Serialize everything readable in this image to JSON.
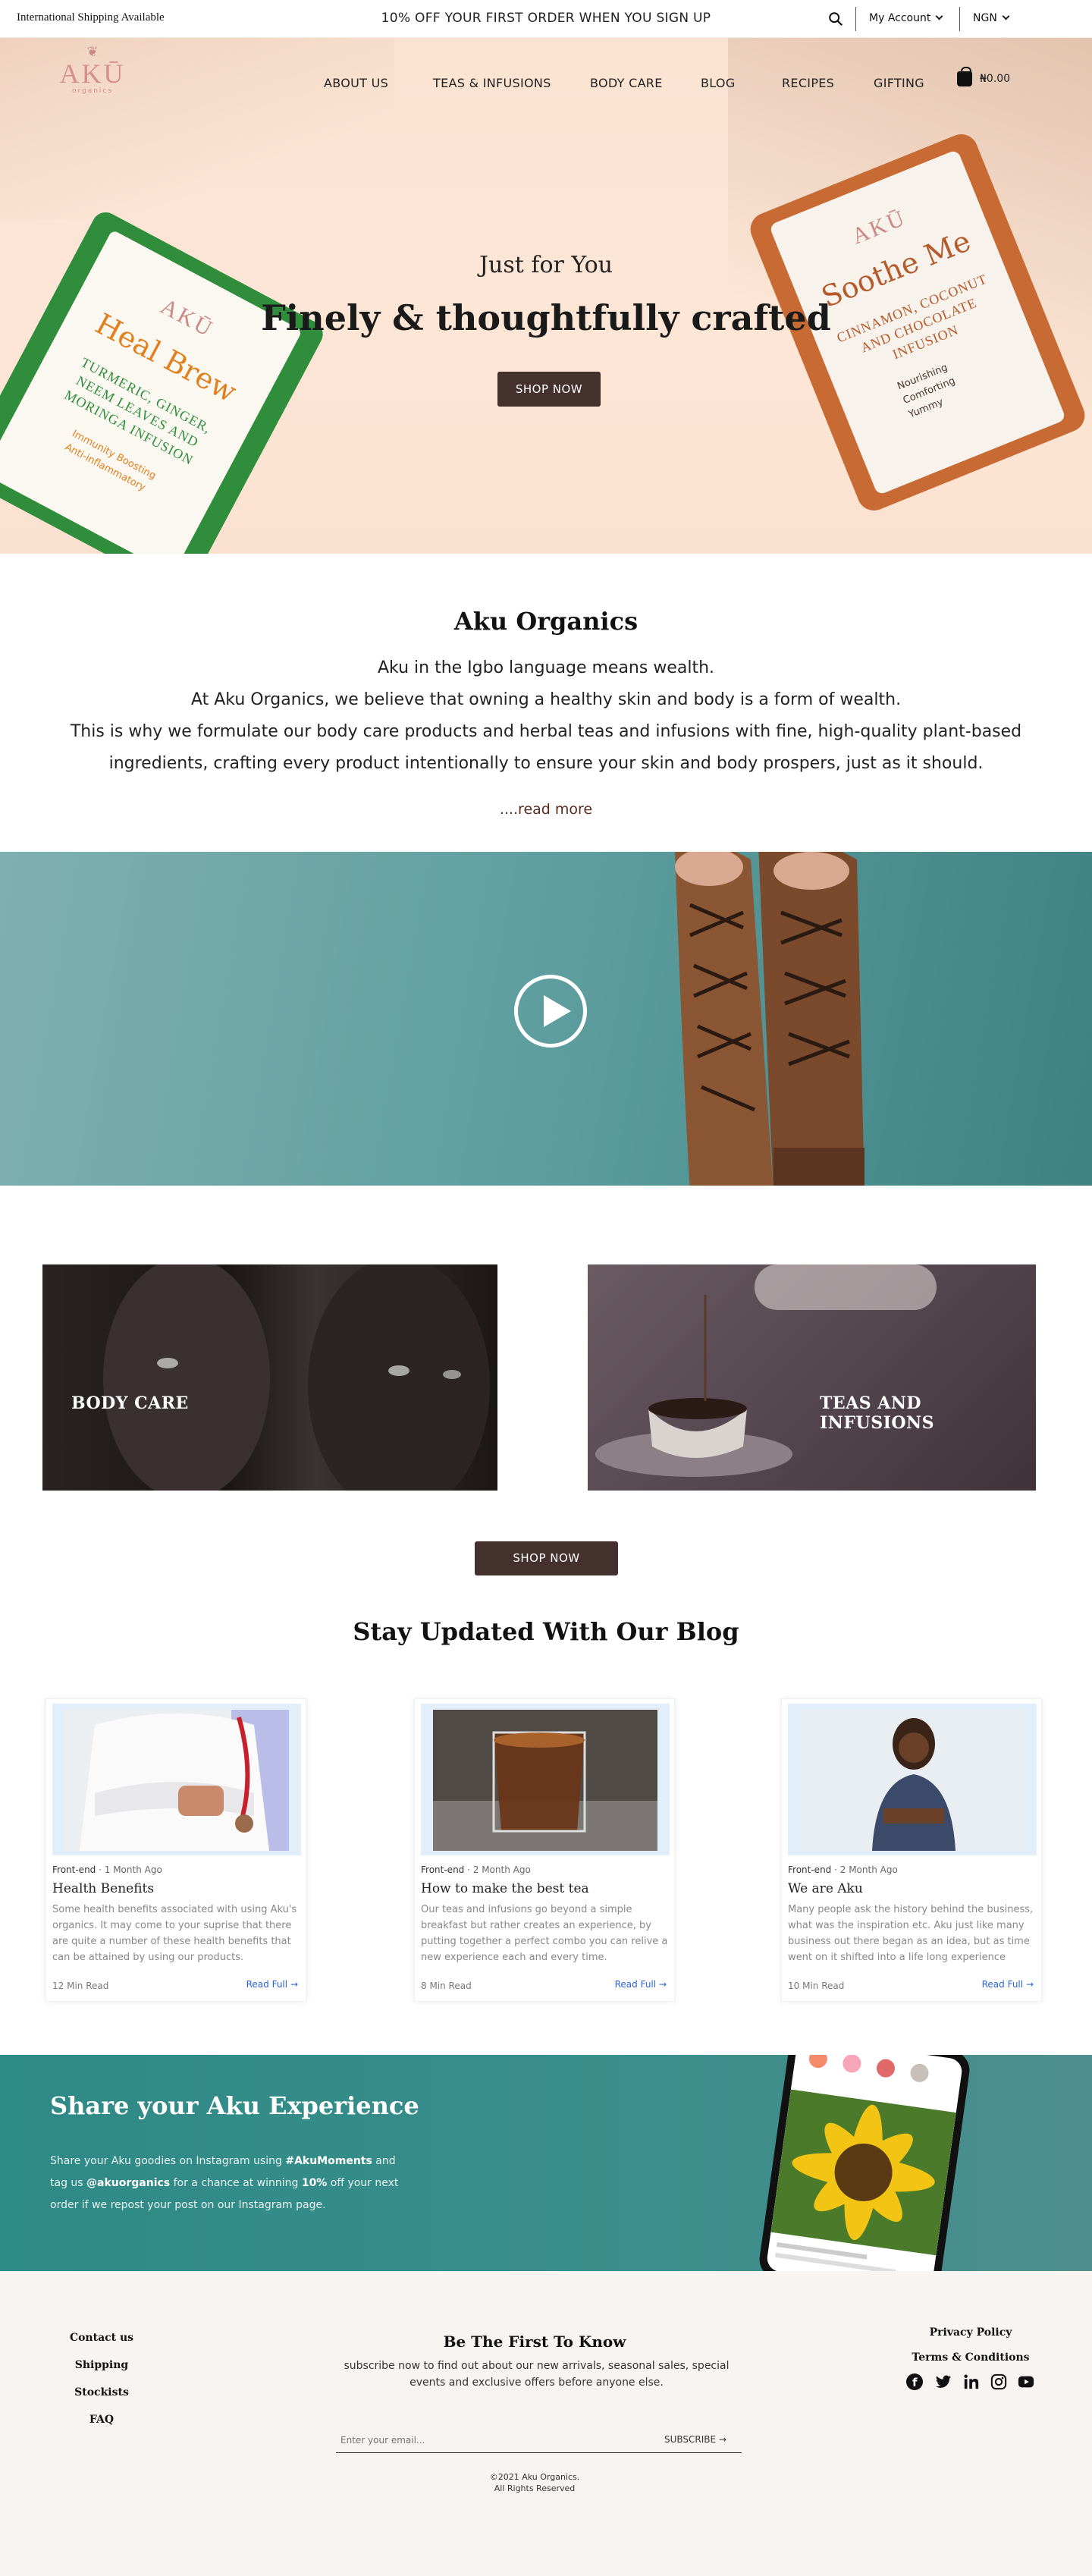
{
  "topbar": {
    "shipping": "International Shipping Available",
    "promo": "10% OFF YOUR FIRST ORDER WHEN YOU SIGN UP",
    "account": "My Account",
    "currency": "NGN"
  },
  "header": {
    "logo": "AKŪ",
    "logo_sub": "organics",
    "nav": [
      "ABOUT US",
      "TEAS & INFUSIONS",
      "BODY CARE",
      "BLOG",
      "RECIPES",
      "GIFTING"
    ],
    "cart_total": "₦0.00"
  },
  "hero": {
    "subtitle": "Just for You",
    "title": "Finely & thoughtfully crafted",
    "button": "SHOP NOW",
    "pack_left": {
      "brand": "AKŪ",
      "name": "Heal Brew",
      "desc": "TURMERIC, GINGER, NEEM LEAVES AND MORINGA INFUSION",
      "list": [
        "Immunity Boosting",
        "Anti-inflammatory"
      ]
    },
    "pack_right": {
      "brand": "AKŪ",
      "name": "Soothe Me",
      "desc": "CINNAMON, COCONUT AND CHOCOLATE INFUSION",
      "list": [
        "Nourishing",
        "Comforting",
        "Yummy"
      ]
    }
  },
  "about": {
    "title": "Aku Organics",
    "lines": [
      "Aku in the Igbo language means wealth.",
      "At Aku Organics, we believe that owning a healthy skin and body is a form of wealth.",
      "This is why we formulate our body care products and herbal teas and infusions with fine, high-quality plant-based",
      "ingredients, crafting every product intentionally to ensure your skin and body prospers, just as it should."
    ],
    "read_more": "....read more"
  },
  "categories": {
    "body_care": "BODY CARE",
    "teas": "TEAS AND INFUSIONS",
    "button": "SHOP NOW"
  },
  "blog": {
    "title": "Stay Updated With Our Blog",
    "posts": [
      {
        "category": "Front-end",
        "date": "1 Month Ago",
        "title": "Health Benefits",
        "excerpt": "Some health benefits associated with using Aku's organics. It may come to your suprise that there are quite a number of these health benefits that can be attained by using our products.",
        "read_time": "12 Min Read",
        "link": "Read Full"
      },
      {
        "category": "Front-end",
        "date": "2 Month Ago",
        "title": "How to make the best tea",
        "excerpt": "Our teas and infusions go beyond a simple breakfast but rather creates an experience, by putting together a perfect combo you can relive a new experience each and every time.",
        "read_time": "8 Min Read",
        "link": "Read Full"
      },
      {
        "category": "Front-end",
        "date": "2 Month Ago",
        "title": "We are Aku",
        "excerpt": "Many people ask the history behind the business, what was the inspiration etc. Aku just like many business out there began as an idea, but as time went on it shifted into a life long experience",
        "read_time": "10 Min Read",
        "link": "Read Full"
      }
    ]
  },
  "share": {
    "title": "Share your Aku Experience",
    "text_1": "Share your Aku goodies on Instagram using ",
    "hashtag": "#AkuMoments",
    "text_2": " and tag us ",
    "handle": "@akuorganics",
    "text_3": " for a chance at winning ",
    "percent": "10%",
    "text_4": " off your next order if we repost your post on our Instagram page."
  },
  "footer": {
    "left_links": [
      "Contact us",
      "Shipping",
      "Stockists",
      "FAQ"
    ],
    "right_links": [
      "Privacy Policy",
      "Terms & Conditions"
    ],
    "newsletter_title": "Be The First To Know",
    "newsletter_text": "subscribe now to find out about our new arrivals, seasonal sales, special events and exclusive offers before anyone else.",
    "email_placeholder": "Enter your email...",
    "subscribe": "SUBSCRIBE",
    "copyright_1": "©2021 Aku Organics.",
    "copyright_2": "All Rights Reserved"
  },
  "colors": {
    "accent_dark": "#44302c",
    "teal": "#3a8e8b",
    "link_blue": "#2a64d8"
  }
}
